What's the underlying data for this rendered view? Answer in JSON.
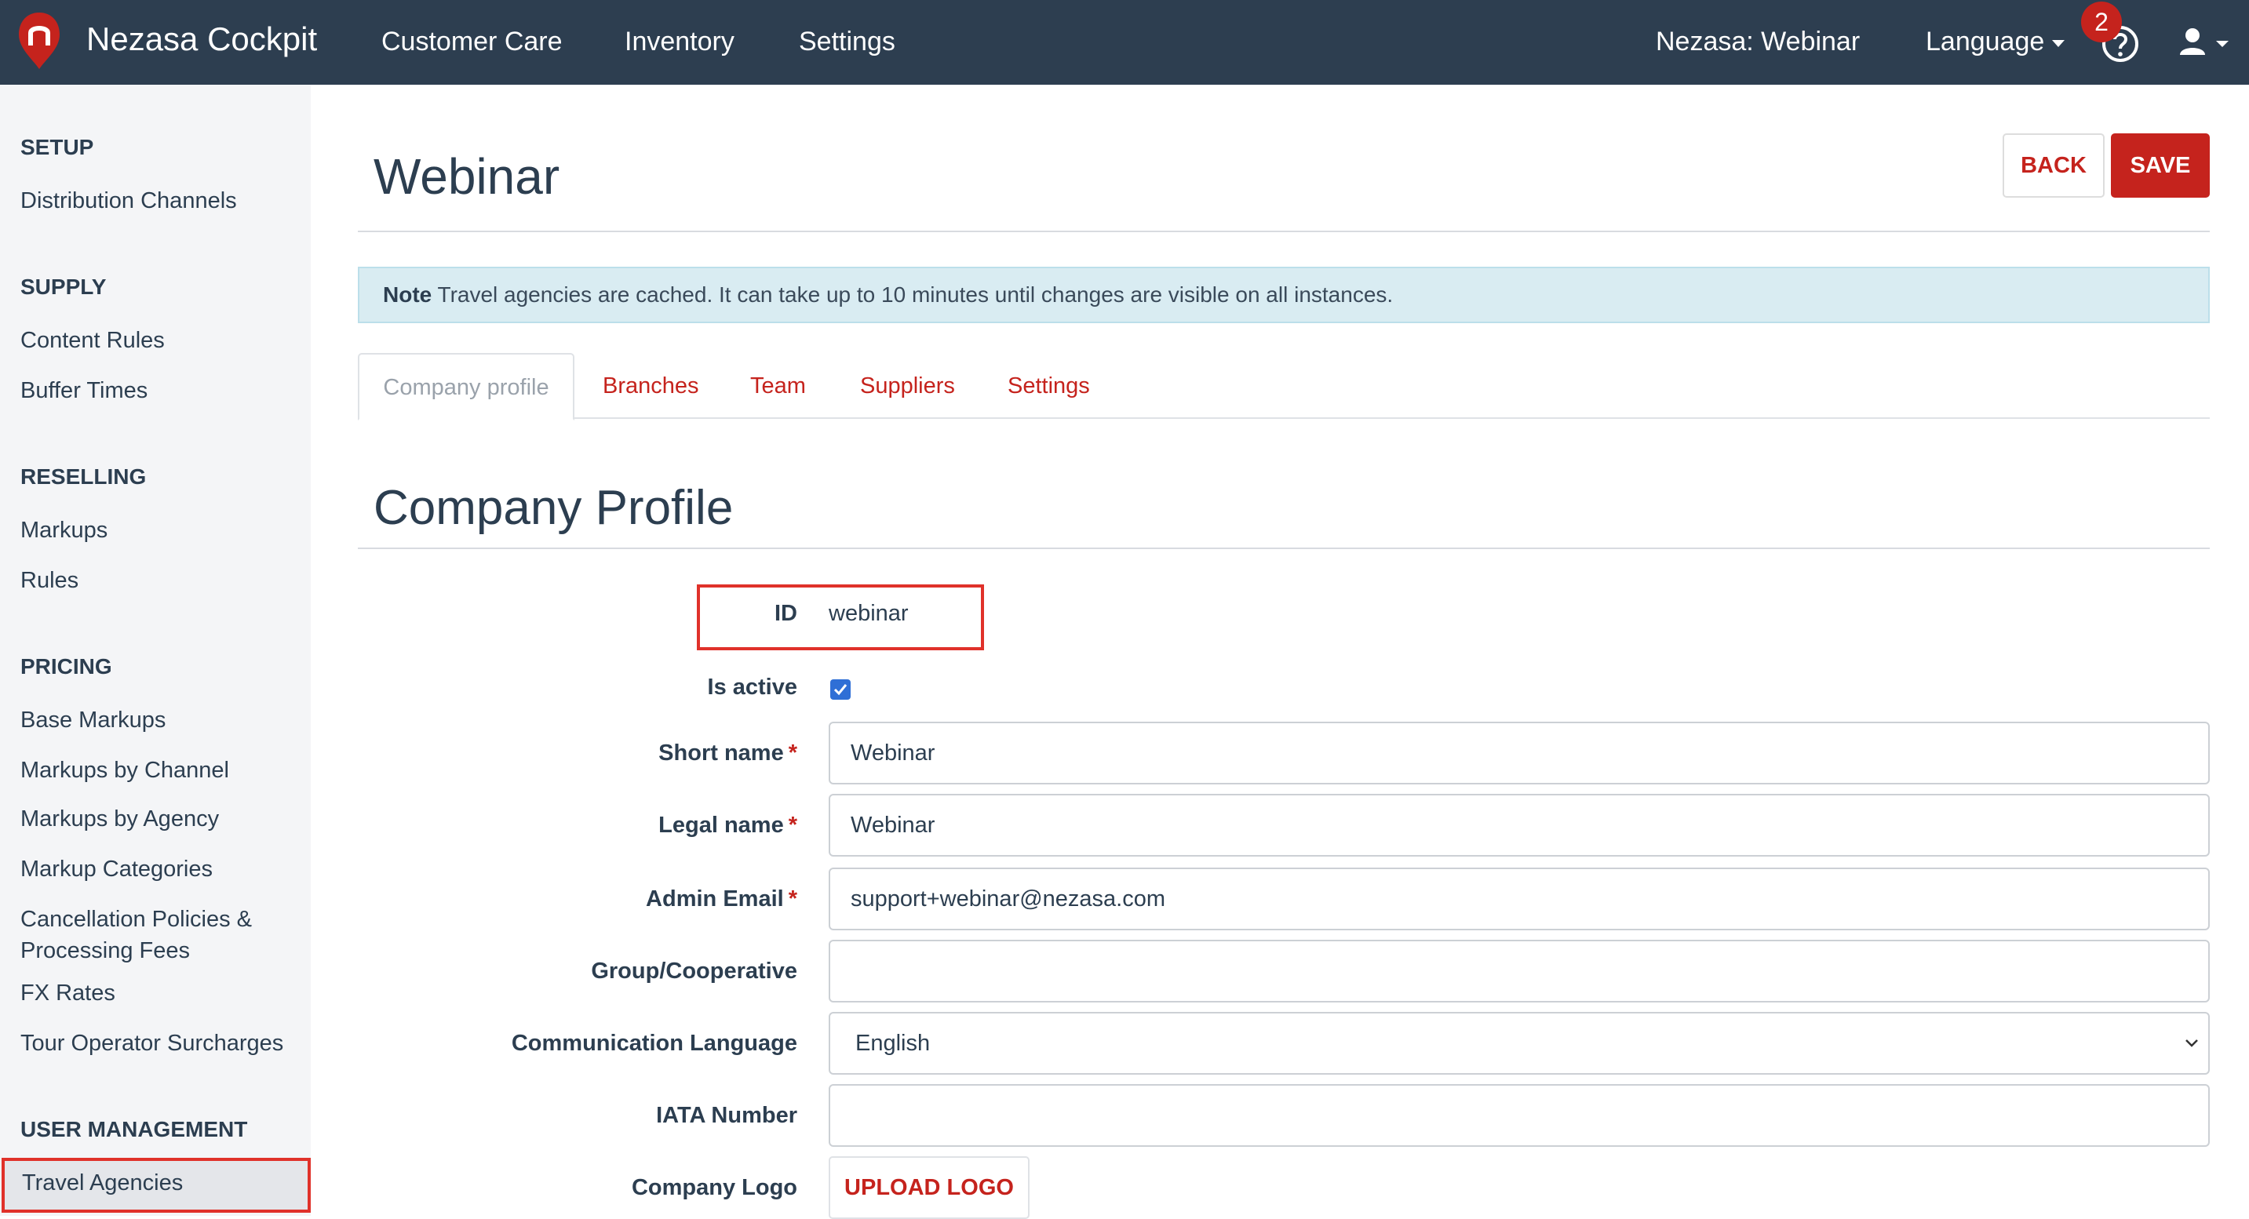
{
  "app": {
    "brand": "Nezasa Cockpit"
  },
  "topnav": {
    "items": [
      "Customer Care",
      "Inventory",
      "Settings"
    ],
    "account": "Nezasa: Webinar",
    "language": "Language",
    "notification_count": "2"
  },
  "sidebar": {
    "setup": {
      "heading": "SETUP",
      "items": [
        "Distribution Channels"
      ]
    },
    "supply": {
      "heading": "SUPPLY",
      "items": [
        "Content Rules",
        "Buffer Times"
      ]
    },
    "reselling": {
      "heading": "RESELLING",
      "items": [
        "Markups",
        "Rules"
      ]
    },
    "pricing": {
      "heading": "PRICING",
      "items": [
        "Base Markups",
        "Markups by Channel",
        "Markups by Agency",
        "Markup Categories",
        "Cancellation Policies &",
        "Processing Fees",
        "FX Rates",
        "Tour Operator Surcharges"
      ]
    },
    "user_management": {
      "heading": "USER MANAGEMENT",
      "items": [
        "Travel Agencies"
      ]
    }
  },
  "page": {
    "title": "Webinar",
    "back_label": "BACK",
    "save_label": "SAVE",
    "note_label": "Note",
    "note_text": " Travel agencies are cached. It can take up to 10 minutes until changes are visible on all instances.",
    "tabs": [
      "Company profile",
      "Branches",
      "Team",
      "Suppliers",
      "Settings"
    ],
    "section_title": "Company Profile"
  },
  "form": {
    "id_label": "ID",
    "id_value": "webinar",
    "is_active_label": "Is active",
    "is_active": true,
    "short_name_label": "Short name",
    "short_name_value": "Webinar",
    "legal_name_label": "Legal name",
    "legal_name_value": "Webinar",
    "admin_email_label": "Admin Email",
    "admin_email_value": "support+webinar@nezasa.com",
    "group_label": "Group/Cooperative",
    "group_value": "",
    "comm_lang_label": "Communication Language",
    "comm_lang_value": "English",
    "iata_label": "IATA Number",
    "iata_value": "",
    "logo_label": "Company Logo",
    "upload_label": "UPLOAD LOGO",
    "required_mark": "*"
  },
  "colors": {
    "nav_bg": "#2d3e50",
    "accent": "#c5231d",
    "note_bg": "#d9ecf2",
    "highlight": "#e0312a"
  },
  "icons": [
    "nezasa-logo-icon",
    "caret-down-icon",
    "help-icon",
    "user-icon",
    "checkbox-checked-icon",
    "chevron-down-icon"
  ]
}
